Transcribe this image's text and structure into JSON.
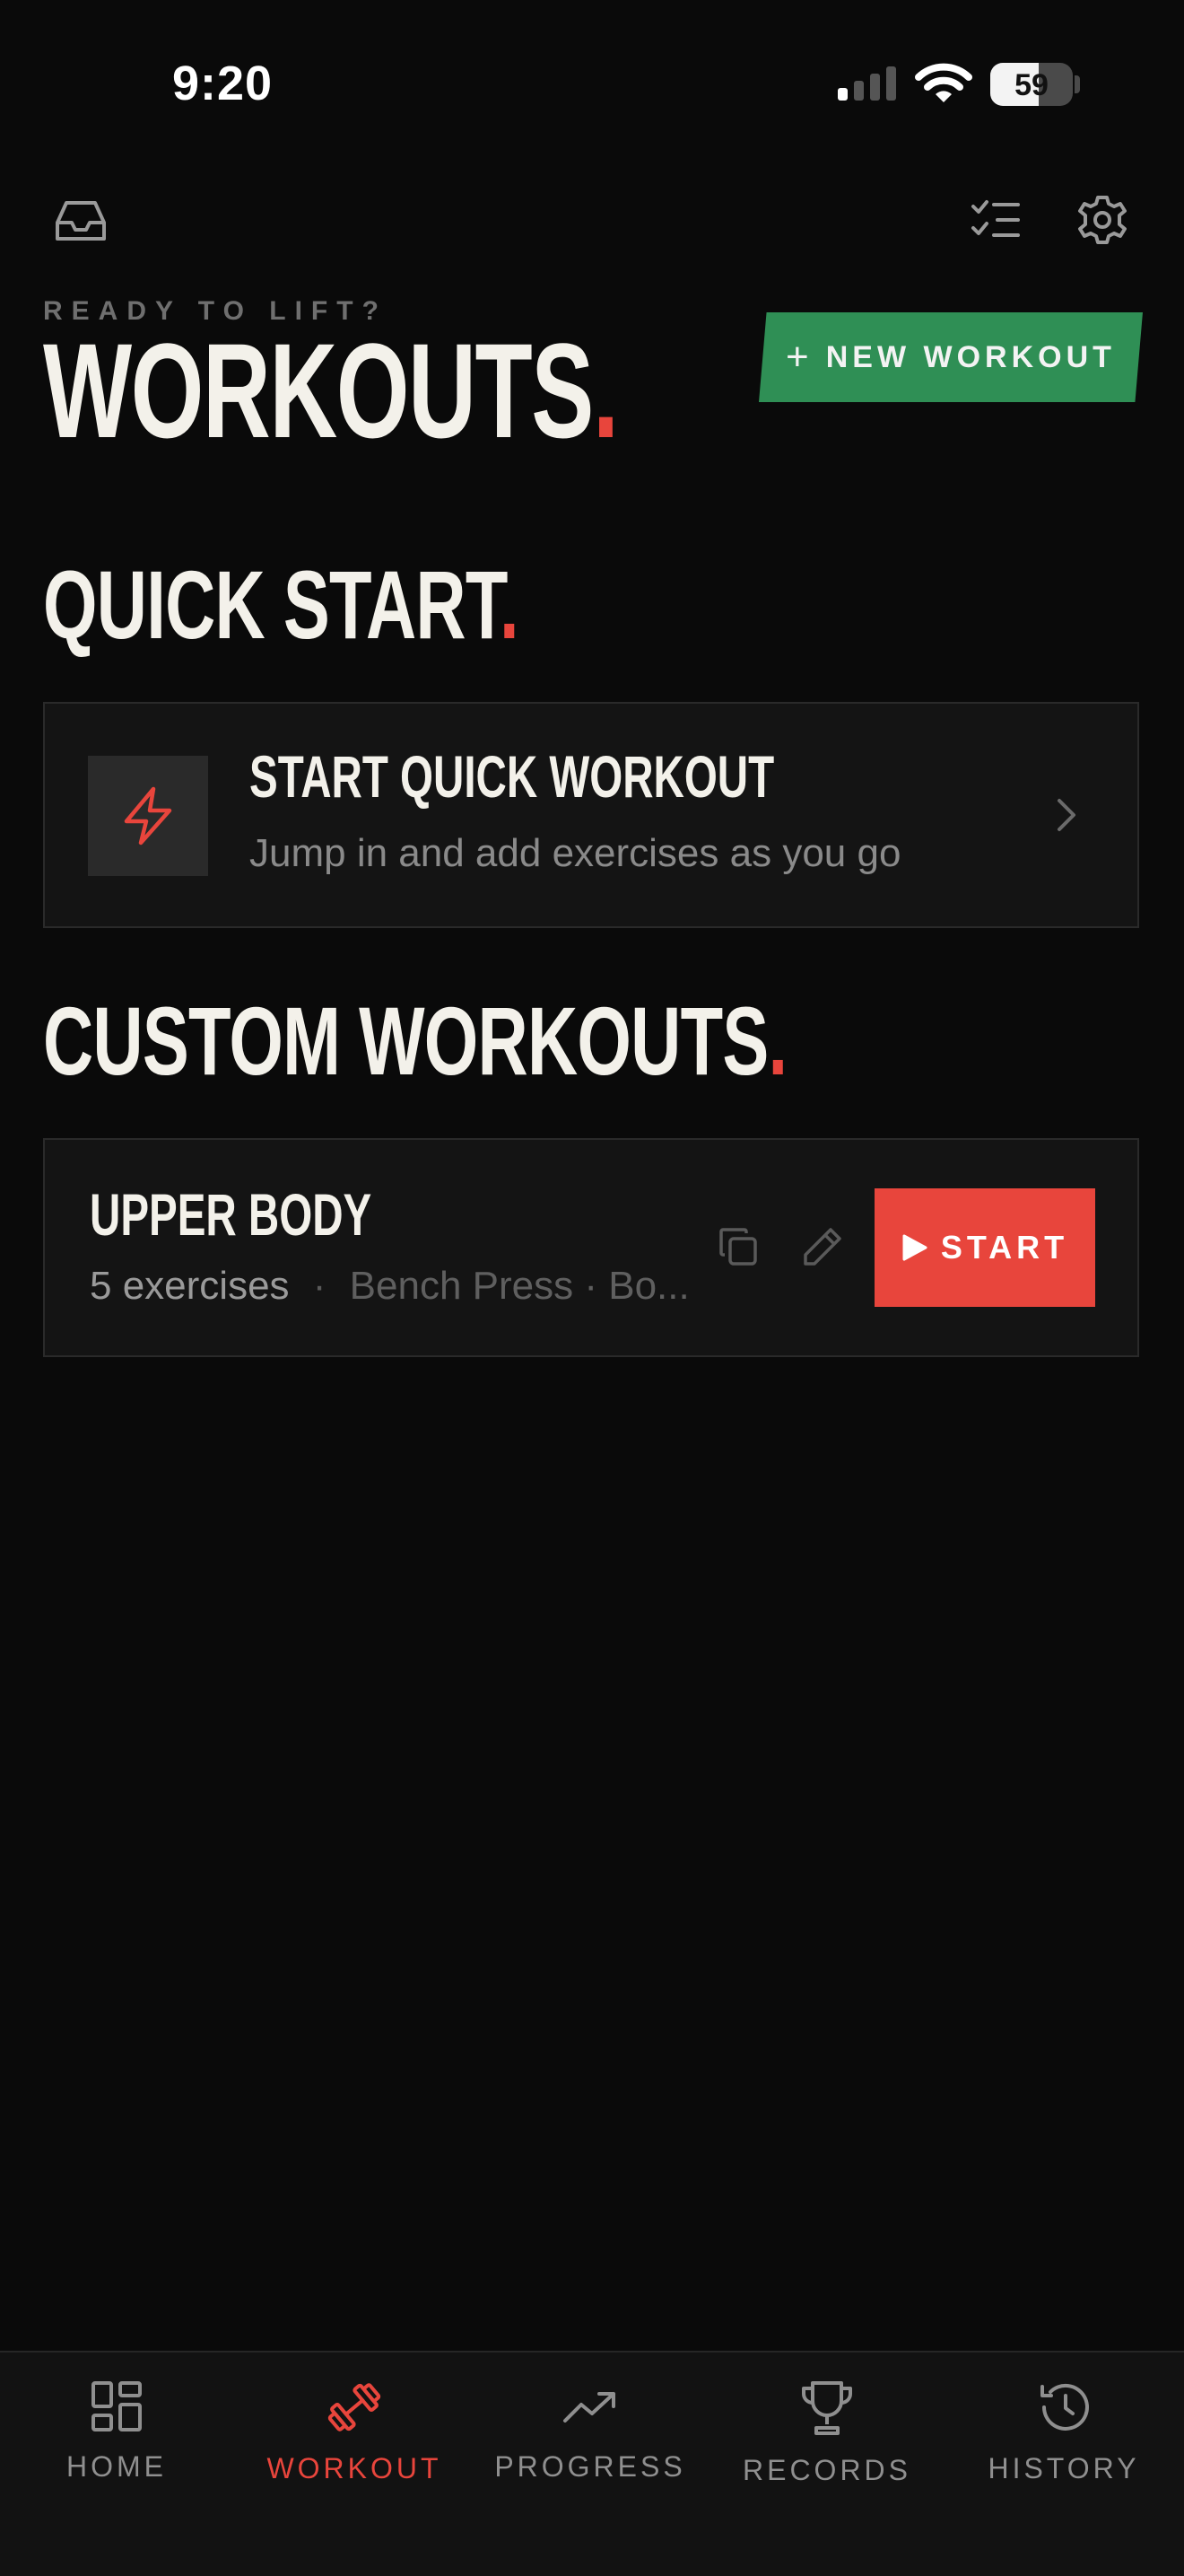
{
  "status_bar": {
    "time": "9:20",
    "battery": "59"
  },
  "header": {
    "eyebrow": "READY TO LIFT?",
    "title": "WORKOUTS",
    "title_dot": ".",
    "new_workout_label": "NEW WORKOUT",
    "new_workout_plus": "+"
  },
  "quick_start": {
    "heading": "QUICK START",
    "heading_dot": ".",
    "card_title": "START QUICK WORKOUT",
    "card_subtitle": "Jump in and add exercises as you go"
  },
  "custom_workouts": {
    "heading": "CUSTOM WORKOUTS",
    "heading_dot": ".",
    "items": [
      {
        "name": "UPPER BODY",
        "count": "5 exercises",
        "separator": "·",
        "preview": "Bench Press · Bo...",
        "start_label": "START"
      }
    ]
  },
  "tabs": [
    {
      "label": "HOME",
      "icon": "grid-icon",
      "active": false
    },
    {
      "label": "WORKOUT",
      "icon": "dumbbell-icon",
      "active": true
    },
    {
      "label": "PROGRESS",
      "icon": "trend-up-icon",
      "active": false
    },
    {
      "label": "RECORDS",
      "icon": "trophy-icon",
      "active": false
    },
    {
      "label": "HISTORY",
      "icon": "history-icon",
      "active": false
    }
  ],
  "colors": {
    "accent": "#e8453c",
    "green": "#2f8f55",
    "background": "#0a0a0a"
  }
}
